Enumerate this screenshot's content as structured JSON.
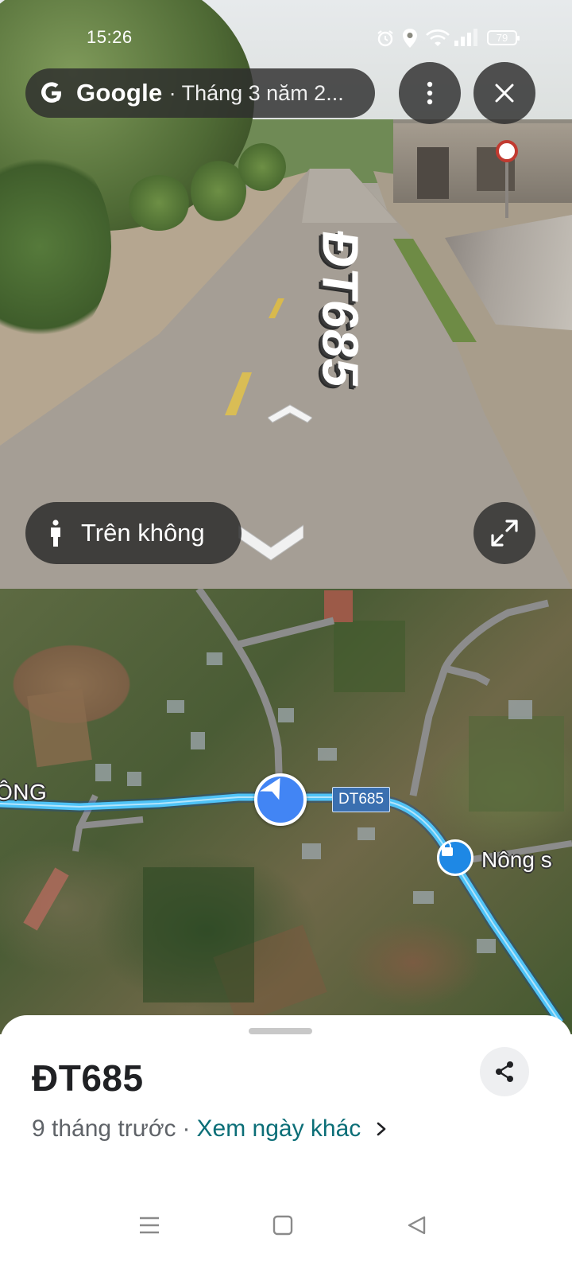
{
  "status_bar": {
    "time": "15:26",
    "battery": "79",
    "icons": [
      "alarm-icon",
      "location-icon",
      "wifi-icon",
      "signal-icon",
      "battery-icon"
    ]
  },
  "street_view": {
    "brand": "Google",
    "date_text": "· Tháng 3 năm 2...",
    "road_label": "ĐT685",
    "aerial_button_label": "Trên không",
    "icons": [
      "google-g-icon",
      "more-vert-icon",
      "close-icon",
      "person-icon",
      "expand-icon",
      "chevron-up-icon",
      "chevron-down-icon"
    ]
  },
  "map": {
    "road_label": "DT685",
    "left_label": "ÔNG",
    "poi_label": "Nông s",
    "route_color": "#4fc3f7"
  },
  "sheet": {
    "title": "ĐT685",
    "age": "9 tháng trước",
    "separator": "·",
    "link": "Xem ngày khác",
    "link_color": "#0b6e77"
  },
  "nav_bar": {
    "icons": [
      "menu-icon",
      "home-square-icon",
      "back-triangle-icon"
    ]
  }
}
